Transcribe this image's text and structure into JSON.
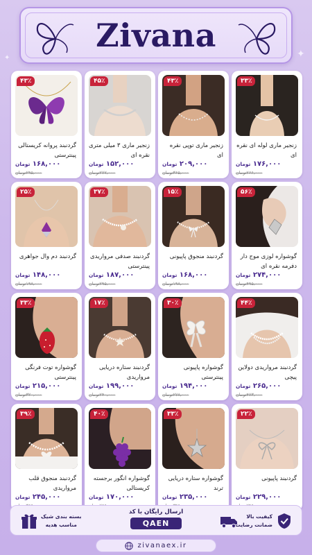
{
  "header": {
    "brand": "Zivana"
  },
  "currency": "تومان",
  "products": [
    {
      "name": "زنجیر ماری لوله ای نقره ای",
      "price": "۱۷۶,۰۰۰",
      "old": "۲۶۶,۰۰۰تومان",
      "discount": "۳۳٪",
      "img": "chain-thin"
    },
    {
      "name": "زنجیر ماری توپی نقره ای",
      "price": "۲۰۹,۰۰۰",
      "old": "۳۶۵,۰۰۰تومان",
      "discount": "۴۳٪",
      "img": "chain-beads"
    },
    {
      "name": "زنجیر ماری ۳ میلی متری نقره ای",
      "price": "۱۵۲,۰۰۰",
      "old": "۲۷۷,۰۰۰تومان",
      "discount": "۴۵٪",
      "img": "chain-flat"
    },
    {
      "name": "گردنبند پروانه کریستالی پینترستی",
      "price": "۱۶۸,۰۰۰",
      "old": "۲۹۵,۰۰۰تومان",
      "discount": "۴۳٪",
      "img": "butterfly"
    },
    {
      "name": "گوشواره لوزی موج دار دفرمه نقره ای",
      "price": "۲۷۴,۰۰۰",
      "old": "۴۹۵,۰۰۰تومان",
      "discount": "۵۶٪",
      "img": "earring-wave"
    },
    {
      "name": "گردنبند منجوق پاپیونی",
      "price": "۱۶۸,۰۰۰",
      "old": "۱۹۸,۰۰۰تومان",
      "discount": "۱۵٪",
      "img": "pearl-bow"
    },
    {
      "name": "گردنبند صدفی مرواریدی پینترستی",
      "price": "۱۸۷,۰۰۰",
      "old": "۲۹۵,۰۰۰تومان",
      "discount": "۳۷٪",
      "img": "pearl-shell"
    },
    {
      "name": "گردنبند دم وال جواهری",
      "price": "۱۴۸,۰۰۰",
      "old": "۱۹۸,۰۰۰تومان",
      "discount": "۲۵٪",
      "img": "whale-tail"
    },
    {
      "name": "گردنبند مرواریدی دولاین پیچی",
      "price": "۲۶۵,۰۰۰",
      "old": "۴۷۳,۰۰۰تومان",
      "discount": "۴۴٪",
      "img": "pearl-double"
    },
    {
      "name": "گوشواره پاپیونی پینترستی",
      "price": "۱۹۴,۰۰۰",
      "old": "۲۷۸,۰۰۰تومان",
      "discount": "۳۰٪",
      "img": "earring-bow"
    },
    {
      "name": "گردنبند ستاره دریایی مرواریدی",
      "price": "۱۹۹,۰۰۰",
      "old": "۲۴۰,۰۰۰تومان",
      "discount": "۱۷٪",
      "img": "starfish-pearl"
    },
    {
      "name": "گوشواره توت فرنگی پینترستی",
      "price": "۲۱۵,۰۰۰",
      "old": "۳۲۰,۰۰۰تومان",
      "discount": "۳۳٪",
      "img": "strawberry"
    },
    {
      "name": "گردنبند پاپیونی",
      "price": "۲۲۹,۰۰۰",
      "old": "۲۹۵,۰۰۰تومان",
      "discount": "۲۲٪",
      "img": "bow-chain"
    },
    {
      "name": "گوشواره ستاره دریایی ترند",
      "price": "۲۳۵,۰۰۰",
      "old": "۳۴۵,۰۰۰تومان",
      "discount": "۳۳٪",
      "img": "earring-star"
    },
    {
      "name": "گوشواره انگور برجسته کریستالی",
      "price": "۱۷۰,۰۰۰",
      "old": "۲۵۵,۰۰۰تومان",
      "discount": "۴۰٪",
      "img": "grape"
    },
    {
      "name": "گردنبند منجوق قلب مرواریدی",
      "price": "۲۴۵,۰۰۰",
      "old": "۳۶۵,۰۰۰تومان",
      "discount": "۳۹٪",
      "img": "heart-pearl"
    }
  ],
  "footer": {
    "quality_title": "کیفیت بالا",
    "quality_sub": "ضمانت رضایت",
    "free_shipping": "ارسال رایگان با کد",
    "code": "QAEN",
    "gift_title": "بسته بندی شیک",
    "gift_sub": "مناسب هدیه"
  },
  "website": "zivanaex.ir",
  "icons": {
    "quality": "shield-check-icon",
    "shipping": "truck-icon",
    "gift": "gift-icon",
    "web": "globe-icon"
  }
}
